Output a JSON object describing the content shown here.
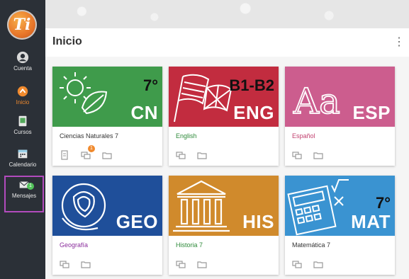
{
  "app": {
    "logo_text": "Ti"
  },
  "sidebar": {
    "items": [
      {
        "label": "Cuenta",
        "icon": "account-icon"
      },
      {
        "label": "Inicio",
        "icon": "home-icon"
      },
      {
        "label": "Cursos",
        "icon": "courses-icon"
      },
      {
        "label": "Calendario",
        "icon": "calendar-icon"
      },
      {
        "label": "Mensajes",
        "icon": "messages-icon",
        "badge": "1"
      }
    ]
  },
  "header": {
    "title": "Inicio",
    "menu_icon": "kebab-menu-icon"
  },
  "colors": {
    "sidebar_bg": "#2b3037",
    "accent": "#f08a2e",
    "highlight": "#b24bbd"
  },
  "courses": [
    {
      "name": "Ciencias Naturales 7",
      "code": "CN",
      "grade": "7°",
      "color": "#3f9b4b",
      "name_color": "#333333",
      "badge": "1"
    },
    {
      "name": "English",
      "code": "ENG",
      "grade": "B1-B2",
      "color": "#c22c3f",
      "name_color": "#2e8a3a"
    },
    {
      "name": "Español",
      "code": "ESP",
      "grade": "",
      "color": "#cc5d8e",
      "name_color": "#c2406f"
    },
    {
      "name": "Geografía",
      "code": "GEO",
      "grade": "",
      "color": "#1f4f9a",
      "name_color": "#8a2d9c"
    },
    {
      "name": "Historia 7",
      "code": "HIS",
      "grade": "",
      "color": "#d08a2c",
      "name_color": "#2e8a3a"
    },
    {
      "name": "Matemática 7",
      "code": "MAT",
      "grade": "7°",
      "color": "#3a93d1",
      "name_color": "#333333"
    }
  ]
}
